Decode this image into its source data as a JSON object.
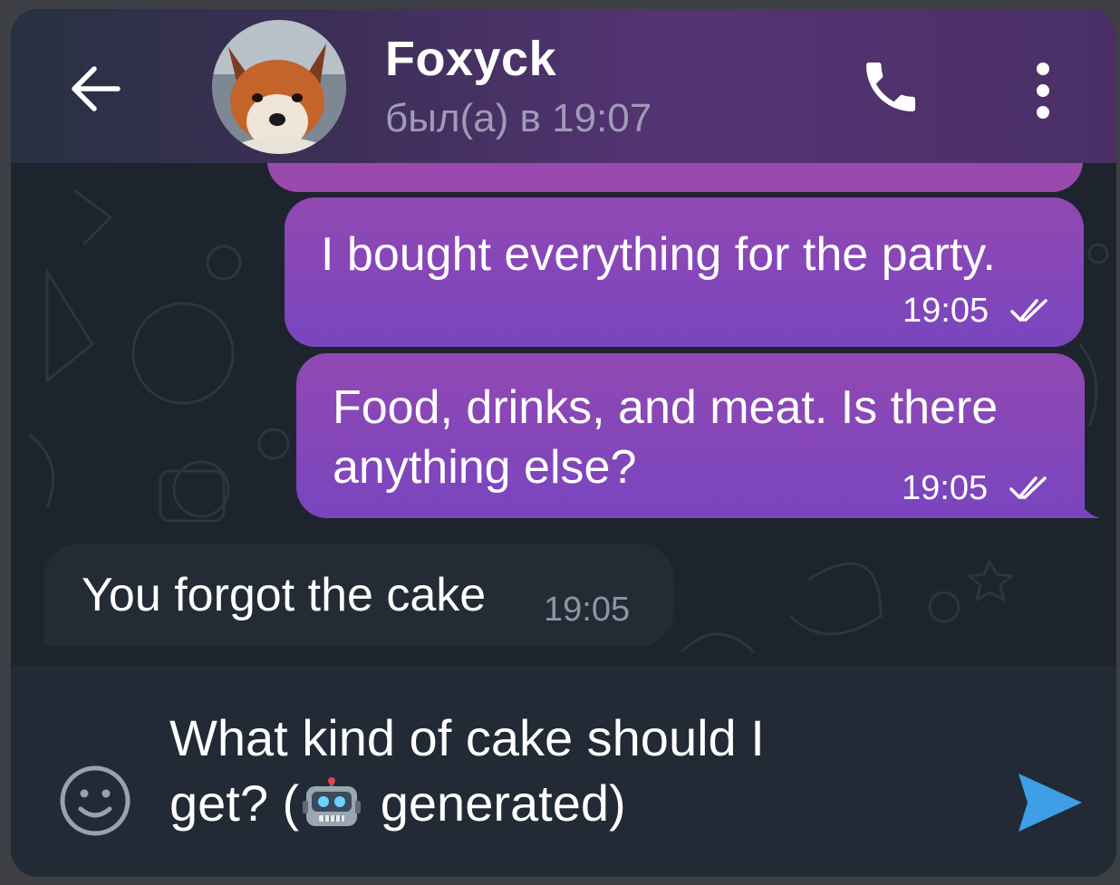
{
  "header": {
    "contact_name": "Foxyck",
    "status": "был(а) в 19:07",
    "avatar_icon": "fox-photo",
    "back_icon": "arrow-left-icon",
    "call_icon": "phone-icon",
    "menu_icon": "more-vertical-icon"
  },
  "messages": [
    {
      "direction": "outgoing",
      "text": "I bought everything for the party.",
      "time": "19:05",
      "status_icon": "double-check-icon"
    },
    {
      "direction": "outgoing",
      "text_line1": "Food, drinks, and meat. Is there",
      "text_line2": "anything else?",
      "time": "19:05",
      "status_icon": "double-check-icon"
    },
    {
      "direction": "incoming",
      "text": "You forgot the cake",
      "time": "19:05"
    }
  ],
  "composer": {
    "text_line1": "What kind of cake should I",
    "text_line2_before": "get? (",
    "text_line2_after": " generated)",
    "robot_icon": "robot-emoji-icon",
    "emoji_icon": "smiley-icon",
    "send_icon": "send-icon"
  },
  "colors": {
    "outgoing_bubble": "#8a47b8",
    "incoming_bubble": "#232b35",
    "chat_background": "#1d242d",
    "send_accent": "#3e9fe6"
  }
}
